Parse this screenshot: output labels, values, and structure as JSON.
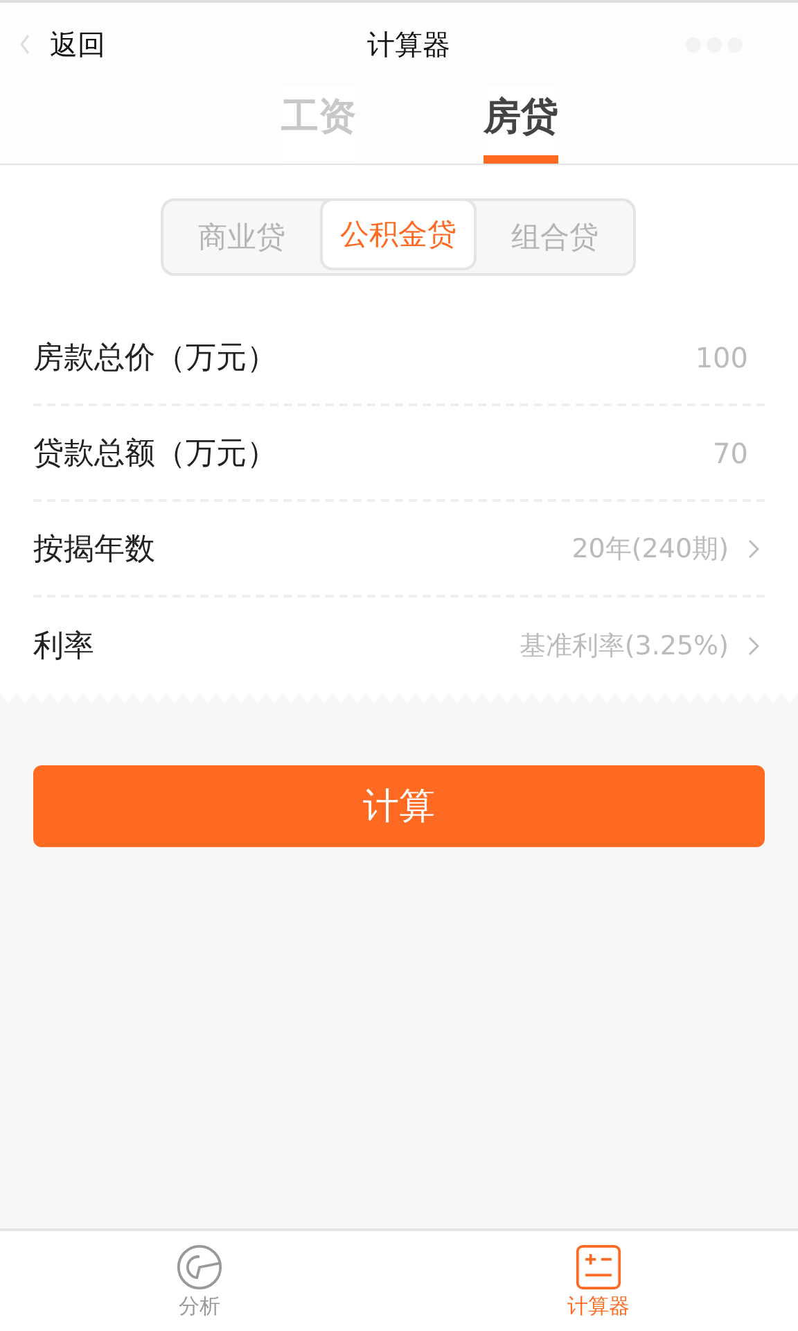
{
  "nav_bar": {
    "back": "返回",
    "title": "计算器"
  },
  "tabs": [
    {
      "label": "工资",
      "selected": false
    },
    {
      "label": "房贷",
      "selected": true
    }
  ],
  "loan_types": [
    {
      "label": "商业贷",
      "selected": false
    },
    {
      "label": "公积金贷",
      "selected": true
    },
    {
      "label": "组合贷",
      "selected": false
    }
  ],
  "form": [
    {
      "kind": "input",
      "label": "房款总价（万元）",
      "value": "100"
    },
    {
      "kind": "input",
      "label": "贷款总额（万元）",
      "value": "70"
    },
    {
      "kind": "select",
      "label": "按揭年数",
      "value": "20年(240期)"
    },
    {
      "kind": "select",
      "label": "利率",
      "value": "基准利率(3.25%)"
    }
  ],
  "calculate_button": "计算",
  "tab_bar": [
    {
      "label": "分析",
      "kind": "chart",
      "selected": false
    },
    {
      "label": "计算器",
      "kind": "calculator",
      "selected": true
    }
  ]
}
